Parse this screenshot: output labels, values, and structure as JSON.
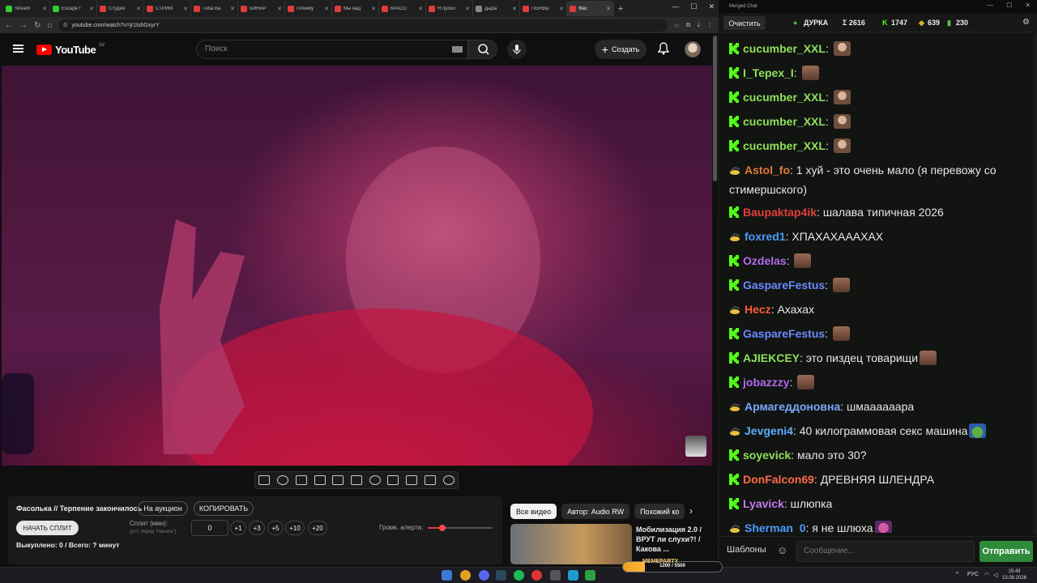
{
  "browser": {
    "tabs": [
      {
        "label": "Stream",
        "color": "#33cc33"
      },
      {
        "label": "Escape f",
        "color": "#33cc33"
      },
      {
        "label": "Студия",
        "color": "#e03a3a"
      },
      {
        "label": "СТРИМ",
        "color": "#e03a3a"
      },
      {
        "label": "Теба Ва",
        "color": "#e03a3a"
      },
      {
        "label": "БИНАР",
        "color": "#e03a3a"
      },
      {
        "label": "Почему",
        "color": "#e03a3a"
      },
      {
        "label": "Мы над",
        "color": "#e03a3a"
      },
      {
        "label": "КРАСО",
        "color": "#e03a3a"
      },
      {
        "label": "Я прохо",
        "color": "#e03a3a"
      },
      {
        "label": "Дыра",
        "color": "#888888"
      },
      {
        "label": "ПЕРВЫ",
        "color": "#e03a3a"
      },
      {
        "label": "Фас",
        "color": "#e03a3a"
      }
    ],
    "url": "youtube.com/watch?v=jr1IshGxyrY"
  },
  "youtube": {
    "logo_text": "YouTube",
    "region": "LV",
    "search_placeholder": "Поиск",
    "create_label": "Создать"
  },
  "panel": {
    "title": "Фасолька // Терпение закончилось",
    "auction_label": "На аукцион",
    "copy_label": "КОПИРОВАТЬ",
    "start_split": "НАЧАТЬ СПЛИТ",
    "split_label": "Сплит (мин):",
    "split_hint": "(уст. перед \"Начать\")",
    "split_value": "0",
    "increments": [
      "+1",
      "+3",
      "+5",
      "+10",
      "+20"
    ],
    "volume_label": "Громк. алерта:",
    "volume_level": 0.23,
    "summary": "Выкуплено: 0 / Всего: ? минут"
  },
  "related": {
    "chips": [
      "Все видео",
      "Автор: Audio RW",
      "Похожий ко"
    ],
    "title": "Мобилизация 2.0 / ВРУТ ли слухи?! / Какова ..."
  },
  "chat": {
    "window_title": "Merged Chat",
    "clear_label": "Очистить",
    "stats": {
      "durka": "ДУРКА",
      "sigma": "Σ 2616",
      "kick": "1747",
      "other": "639",
      "money": "230"
    },
    "messages": [
      {
        "platform": "kick",
        "user": "cucumber_XXL",
        "color": "#8fe05a",
        "text": "",
        "emote": "face"
      },
      {
        "platform": "kick",
        "user": "I_Tepex_I",
        "color": "#8fe05a",
        "text": "",
        "emote": "face2"
      },
      {
        "platform": "kick",
        "user": "cucumber_XXL",
        "color": "#8fe05a",
        "text": "",
        "emote": "face"
      },
      {
        "platform": "kick",
        "user": "cucumber_XXL",
        "color": "#8fe05a",
        "text": "",
        "emote": "face"
      },
      {
        "platform": "kick",
        "user": "cucumber_XXL",
        "color": "#8fe05a",
        "text": "",
        "emote": "face"
      },
      {
        "platform": "vk",
        "user": "Astol_fo",
        "color": "#e07a3a",
        "text": "1 хуй - это очень мало (я перевожу со стимершского)",
        "emote": ""
      },
      {
        "platform": "kick",
        "user": "Baupaktap4ik",
        "color": "#e0403a",
        "text": "шалава типичная 2026",
        "emote": ""
      },
      {
        "platform": "vk",
        "user": "foxred1",
        "color": "#4a9aff",
        "text": "ХПАХАХАААХАХ",
        "emote": ""
      },
      {
        "platform": "kick",
        "user": "Ozdelas",
        "color": "#b06ae8",
        "text": "",
        "emote": "face2"
      },
      {
        "platform": "kick",
        "user": "GaspareFestus",
        "color": "#6a8aff",
        "text": "",
        "emote": "face2"
      },
      {
        "platform": "vk",
        "user": "Hecz",
        "color": "#ff5a3a",
        "text": "Ахахах",
        "emote": ""
      },
      {
        "platform": "kick",
        "user": "GaspareFestus",
        "color": "#6a8aff",
        "text": "",
        "emote": "face2"
      },
      {
        "platform": "kick",
        "user": "AJIEKCEY",
        "color": "#8fe05a",
        "text": "это пиздец товарищи",
        "emote": "face2"
      },
      {
        "platform": "kick",
        "user": "jobazzzy",
        "color": "#b06ae8",
        "text": "",
        "emote": "face2"
      },
      {
        "platform": "vk",
        "user": "Армагеддоновна",
        "color": "#7aa8ff",
        "text": "шмаааааара",
        "emote": ""
      },
      {
        "platform": "vk",
        "user": "Jevgeni4",
        "color": "#5ab0ff",
        "text": "40 килограммовая секс машина",
        "emote": "pepe"
      },
      {
        "platform": "kick",
        "user": "soyevick",
        "color": "#8fe05a",
        "text": "мало это 30?",
        "emote": ""
      },
      {
        "platform": "kick",
        "user": "DonFalcon69",
        "color": "#ff6a4a",
        "text": "ДРЕВНЯЯ ШЛЕНДРА",
        "emote": ""
      },
      {
        "platform": "kick",
        "user": "Lyavick",
        "color": "#c07af0",
        "text": "шлюпка",
        "emote": ""
      },
      {
        "platform": "vk",
        "user": "Sherman_0",
        "color": "#4a9aff",
        "text": "я не шлюха",
        "emote": "girl"
      }
    ],
    "templates_label": "Шаблоны",
    "input_placeholder": "Сообщение...",
    "send_label": "Отправить"
  },
  "taskbar": {
    "lang": "РУС",
    "time": "15:43",
    "date": "13.08.2026",
    "meme_label": "MEMEPARTY",
    "meme_progress": "1200 / 5500",
    "meme_fraction": 0.22
  }
}
